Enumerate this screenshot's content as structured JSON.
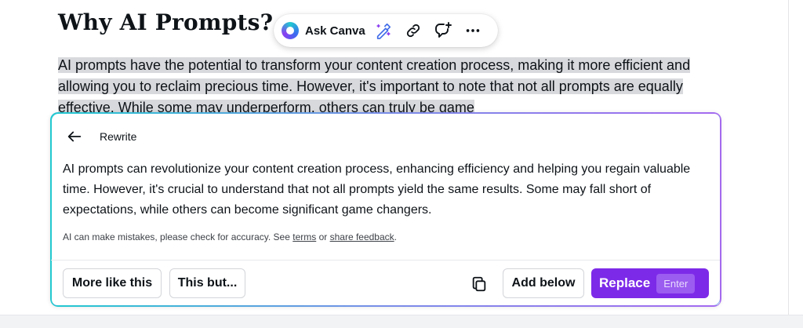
{
  "document": {
    "title": "Why AI Prompts?",
    "body": "AI prompts have the potential to transform your content creation process, making it more efficient and allowing you to reclaim precious time. However, it's important to note that not all prompts are equally effective. While some may underperform, others can truly be game"
  },
  "toolbar": {
    "ask_label": "Ask Canva",
    "icons": [
      "canva-assistant-logo-icon",
      "magic-write-icon",
      "link-icon",
      "add-comment-icon",
      "more-options-icon"
    ]
  },
  "rewrite_panel": {
    "title": "Rewrite",
    "result_text": "AI prompts can revolutionize your content creation process, enhancing efficiency and helping you regain valuable time. However, it's crucial to understand that not all prompts yield the same results. Some may fall short of expectations, while others can become significant game changers.",
    "disclaimer_prefix": "AI can make mistakes, please check for accuracy. See ",
    "terms_link": "terms",
    "disclaimer_middle": " or ",
    "feedback_link": "share feedback",
    "disclaimer_suffix": ".",
    "buttons": {
      "more_like_this": "More like this",
      "this_but": "This but...",
      "add_below": "Add below",
      "replace": "Replace",
      "replace_shortcut": "Enter"
    }
  },
  "colors": {
    "accent": "#7d2ae8",
    "panel_border_start": "#21c9d0",
    "panel_border_end": "#a46af0",
    "selection_highlight": "#d8d9dc"
  }
}
